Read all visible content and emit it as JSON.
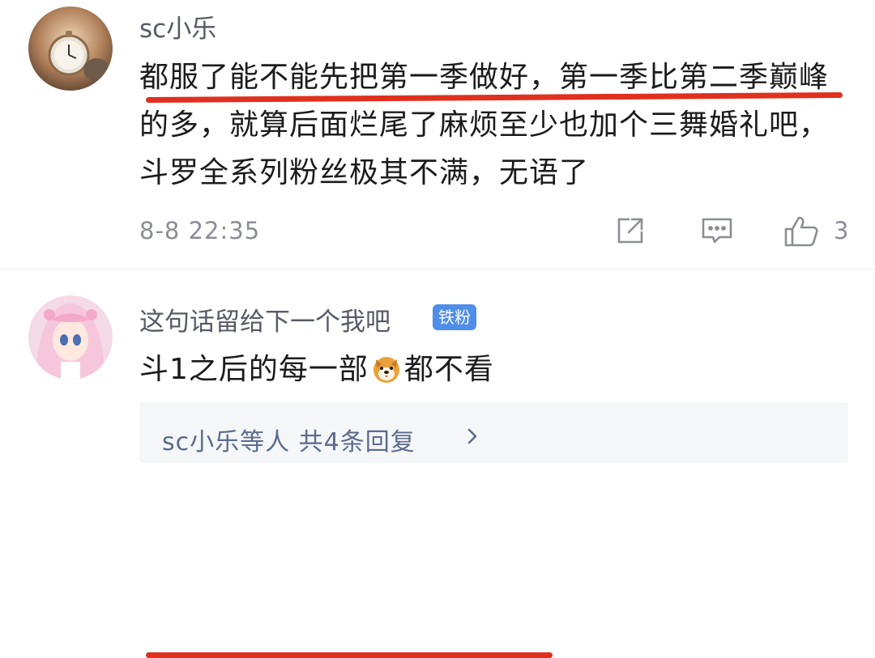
{
  "comment1": {
    "username": "sc小乐",
    "text": "都服了能不能先把第一季做好，第一季比第二季巅峰的多，就算后面烂尾了麻烦至少也加个三舞婚礼吧，斗罗全系列粉丝极其不满，无语了",
    "time": "8-8 22:35",
    "like_count": "3",
    "icons": [
      "share-icon",
      "reply-icon",
      "like-icon"
    ]
  },
  "comment2": {
    "username": "这句话留给下一个我吧",
    "badge": "铁粉",
    "text_before": "斗1之后的每一部",
    "emoji": "dog-emoji",
    "text_after": "都不看"
  },
  "reply_summary": {
    "text": "sc小乐等人 共4条回复",
    "icon": "chevron-right-icon"
  },
  "colors": {
    "underline": "#e0301e",
    "badge": "#4f8ee8",
    "reply_text": "#5b6b8c"
  }
}
